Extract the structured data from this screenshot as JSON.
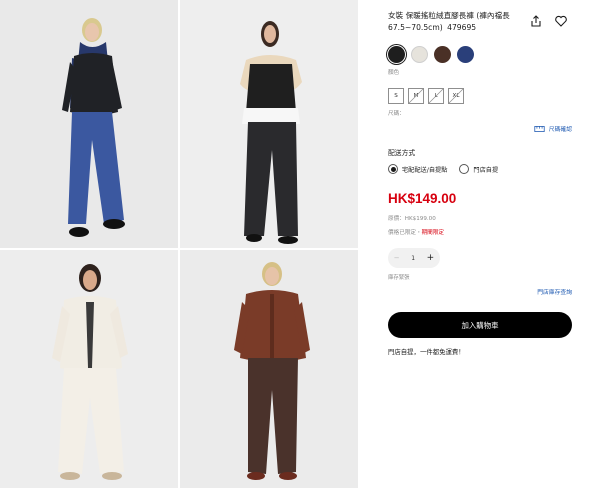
{
  "product": {
    "title": "女裝 保暖搖粒絨直腳長褲 (褲內襠長67.5~70.5cm)",
    "code": "479695"
  },
  "actions": {
    "share_icon": "share-icon",
    "favorite_icon": "heart-icon"
  },
  "colors": {
    "label": "顏色",
    "swatches": [
      {
        "name": "black",
        "hex": "#1e1e1e",
        "selected": true
      },
      {
        "name": "off-white",
        "hex": "#e6e3dc",
        "selected": false
      },
      {
        "name": "dark-brown",
        "hex": "#4a3026",
        "selected": false
      },
      {
        "name": "navy",
        "hex": "#2a3f7a",
        "selected": false
      }
    ]
  },
  "sizes": {
    "label": "尺碼：",
    "options": [
      {
        "label": "S",
        "available": true
      },
      {
        "label": "M",
        "available": false
      },
      {
        "label": "L",
        "available": false
      },
      {
        "label": "XL",
        "available": false
      }
    ],
    "guide_label": "尺碼確認",
    "guide_icon": "ruler-icon"
  },
  "shipping": {
    "title": "配送方式",
    "options": [
      {
        "label": "宅配配送/自提點",
        "selected": true
      },
      {
        "label": "門店自提",
        "selected": false
      }
    ]
  },
  "pricing": {
    "price": "HK$149.00",
    "original": "原價：HK$199.00",
    "promo_prefix": "價格已限定・",
    "promo_highlight": "期間限定"
  },
  "quantity": {
    "minus": "−",
    "value": "1",
    "plus": "+"
  },
  "stock": {
    "text": "庫存緊張",
    "store_link": "門店庫存查詢"
  },
  "cart": {
    "button_label": "加入購物車",
    "note": "門店自提，一件都免運費！"
  },
  "theme": {
    "accent_red": "#d7000f",
    "link_blue": "#1b57b0",
    "button_black": "#000000"
  }
}
